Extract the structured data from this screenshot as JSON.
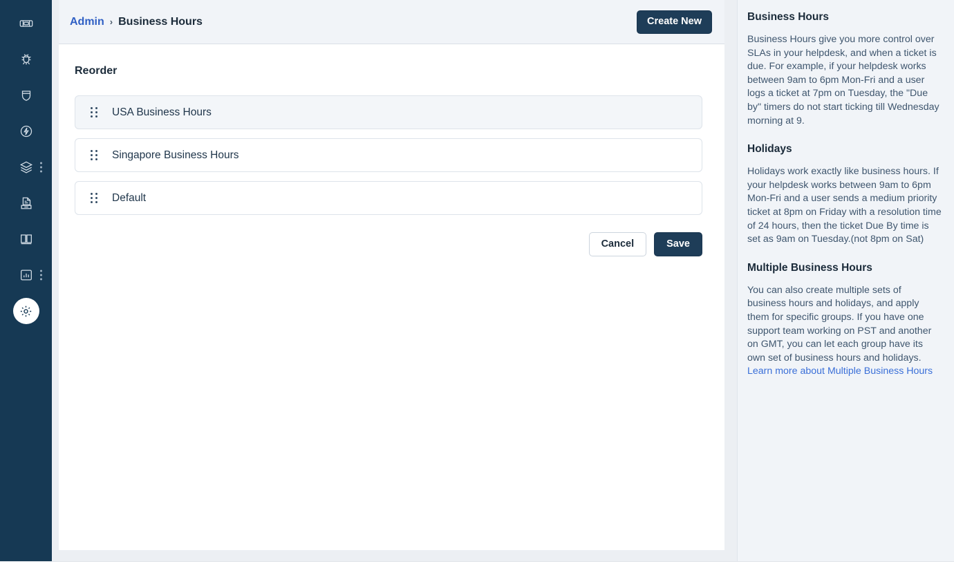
{
  "sidebar": {
    "items": [
      {
        "name": "tickets",
        "icon": "ticket-icon",
        "active": false,
        "kebab": false
      },
      {
        "name": "bugs",
        "icon": "bug-icon",
        "active": false,
        "kebab": false
      },
      {
        "name": "shield",
        "icon": "shield-icon",
        "active": false,
        "kebab": false
      },
      {
        "name": "automation",
        "icon": "bolt-circle-icon",
        "active": false,
        "kebab": false
      },
      {
        "name": "assets",
        "icon": "layers-icon",
        "active": false,
        "kebab": true
      },
      {
        "name": "archive",
        "icon": "archive-doc-icon",
        "active": false,
        "kebab": false
      },
      {
        "name": "knowledge",
        "icon": "book-icon",
        "active": false,
        "kebab": false
      },
      {
        "name": "reports",
        "icon": "chart-bar-icon",
        "active": false,
        "kebab": true
      },
      {
        "name": "admin",
        "icon": "gear-icon",
        "active": true,
        "kebab": false
      }
    ]
  },
  "header": {
    "breadcrumb_parent": "Admin",
    "breadcrumb_separator": "›",
    "breadcrumb_current": "Business Hours",
    "create_new_label": "Create New"
  },
  "main": {
    "section_title": "Reorder",
    "reorder_items": [
      {
        "label": "USA Business Hours",
        "active": true
      },
      {
        "label": "Singapore Business Hours",
        "active": false
      },
      {
        "label": "Default",
        "active": false
      }
    ],
    "cancel_label": "Cancel",
    "save_label": "Save"
  },
  "help_panel": {
    "sections": [
      {
        "heading": "Business Hours",
        "body": "Business Hours give you more control over SLAs in your helpdesk, and when a ticket is due. For example, if your helpdesk works between 9am to 6pm Mon-Fri and a user logs a ticket at 7pm on Tuesday, the \"Due by\" timers do not start ticking till Wednesday morning at 9."
      },
      {
        "heading": "Holidays",
        "body": "Holidays work exactly like business hours. If your helpdesk works between 9am to 6pm Mon-Fri and a user sends a medium priority ticket at 8pm on Friday with a resolution time of 24 hours, then the ticket Due By time is set as 9am on Tuesday.(not 8pm on Sat)"
      },
      {
        "heading": "Multiple Business Hours",
        "body": "You can also create multiple sets of business hours and holidays, and apply them for specific groups. If you have one support team working on PST and another on GMT, you can let each group have its own set of business hours and holidays. ",
        "link_text": "Learn more about Multiple Business Hours"
      }
    ]
  },
  "colors": {
    "sidebar_bg": "#163954",
    "primary_button": "#1e3d58",
    "link": "#3a6fd8",
    "breadcrumb_link": "#2f5fc4",
    "panel_bg": "#f1f4f8",
    "active_row_bg": "#f3f6f9"
  }
}
